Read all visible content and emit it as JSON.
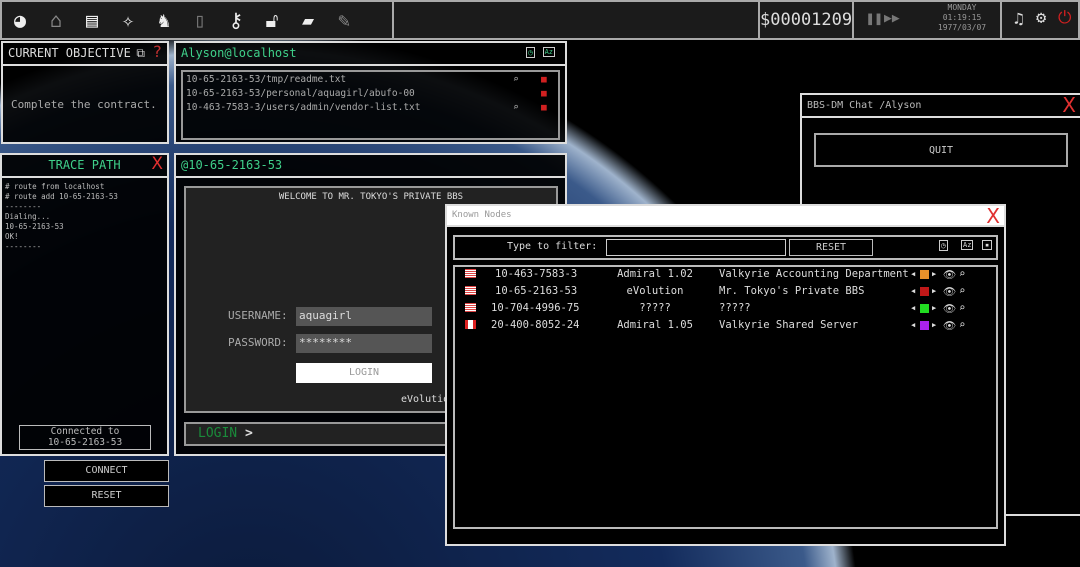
{
  "toolbar": {
    "icons": [
      "globe-icon",
      "home-globe-icon",
      "newspaper-icon",
      "constellation-icon",
      "spy-icon",
      "notes-icon",
      "key-icon",
      "lock-icon",
      "book-icon",
      "notepad-icon"
    ]
  },
  "status": {
    "money": "$00001209",
    "day": "MONDAY",
    "time": "01:19:15",
    "date": "1977/03/07"
  },
  "objective": {
    "title": "CURRENT OBJECTIVE",
    "help": "?",
    "text": "Complete the contract."
  },
  "localhost": {
    "title": "Alyson@localhost",
    "files": [
      "10-65-2163-53/tmp/readme.txt",
      "10-65-2163-53/personal/aquagirl/abufo-00",
      "10-463-7583-3/users/admin/vendor-list.txt"
    ]
  },
  "trace": {
    "title": "TRACE PATH",
    "close": "X",
    "log": [
      "# route from localhost",
      "# route add 10-65-2163-53",
      "--------",
      "Dialing...",
      "10-65-2163-53",
      "OK!",
      "--------"
    ],
    "connected_label": "Connected to",
    "connected_host": "10-65-2163-53",
    "connect": "CONNECT",
    "reset": "RESET"
  },
  "bbs": {
    "title": "@10-65-2163-53",
    "welcome": "WELCOME TO MR. TOKYO'S PRIVATE BBS",
    "username_label": "USERNAME:",
    "username": "aquagirl",
    "password_label": "PASSWORD:",
    "password": "********",
    "login_button": "LOGIN",
    "brand": "eVolution",
    "prompt": "LOGIN",
    "prompt_arrow": ">"
  },
  "chat": {
    "title": "BBS-DM Chat /Alyson",
    "close": "X",
    "quit": "QUIT"
  },
  "nodes": {
    "title": "Known Nodes",
    "close": "X",
    "filter_label": "Type to filter:",
    "filter_value": "",
    "reset": "RESET",
    "sort_az": "Az",
    "rows": [
      {
        "flag": "us",
        "ip": "10-463-7583-3",
        "software": "Admiral 1.02",
        "name": "Valkyrie Accounting Department",
        "color": "#e8912a"
      },
      {
        "flag": "us",
        "ip": "10-65-2163-53",
        "software": "eVolution",
        "name": "Mr. Tokyo's Private BBS",
        "color": "#c01818"
      },
      {
        "flag": "us",
        "ip": "10-704-4996-75",
        "software": "?????",
        "name": "?????",
        "color": "#22dd22"
      },
      {
        "flag": "ca",
        "ip": "20-400-8052-24",
        "software": "Admiral 1.05",
        "name": "Valkyrie Shared Server",
        "color": "#aa22ee"
      }
    ]
  }
}
